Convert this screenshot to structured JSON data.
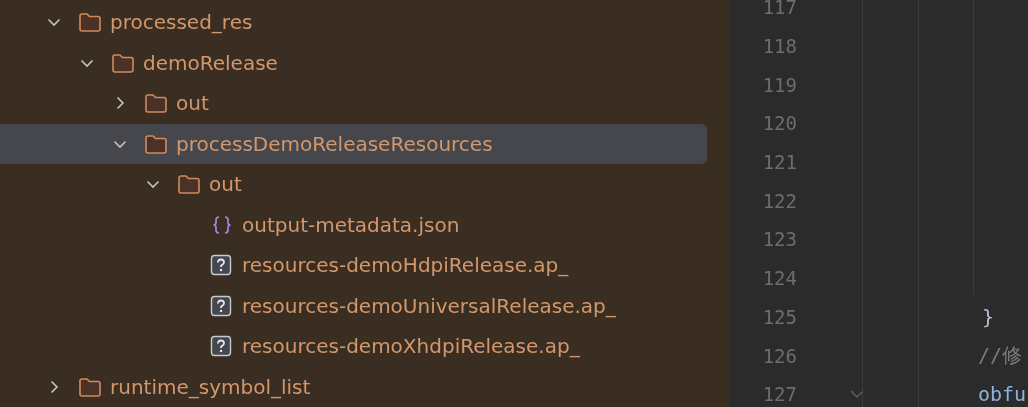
{
  "project_tree": {
    "items": [
      {
        "name": "processed_res",
        "kind": "folder",
        "expanded": true,
        "selected": false,
        "children": [
          {
            "name": "demoRelease",
            "kind": "folder",
            "expanded": true,
            "selected": false,
            "children": [
              {
                "name": "out",
                "kind": "folder",
                "expanded": false,
                "selected": false
              },
              {
                "name": "processDemoReleaseResources",
                "kind": "folder",
                "expanded": true,
                "selected": true,
                "children": [
                  {
                    "name": "out",
                    "kind": "folder",
                    "expanded": true,
                    "selected": false,
                    "children": [
                      {
                        "name": "output-metadata.json",
                        "kind": "json",
                        "selected": false
                      },
                      {
                        "name": "resources-demoHdpiRelease.ap_",
                        "kind": "unknown",
                        "selected": false
                      },
                      {
                        "name": "resources-demoUniversalRelease.ap_",
                        "kind": "unknown",
                        "selected": false
                      },
                      {
                        "name": "resources-demoXhdpiRelease.ap_",
                        "kind": "unknown",
                        "selected": false
                      }
                    ]
                  }
                ]
              }
            ]
          }
        ]
      },
      {
        "name": "runtime_symbol_list",
        "kind": "folder",
        "expanded": false,
        "selected": false
      }
    ]
  },
  "editor": {
    "lines": [
      {
        "number": "117"
      },
      {
        "number": "118"
      },
      {
        "number": "119"
      },
      {
        "number": "120"
      },
      {
        "number": "121"
      },
      {
        "number": "122"
      },
      {
        "number": "123"
      },
      {
        "number": "124"
      },
      {
        "number": "125",
        "code": "}",
        "kind": "brace"
      },
      {
        "number": "126",
        "code": "//修",
        "kind": "comment"
      },
      {
        "number": "127",
        "code": "obfu",
        "kind": "code",
        "foldable": true
      }
    ]
  }
}
